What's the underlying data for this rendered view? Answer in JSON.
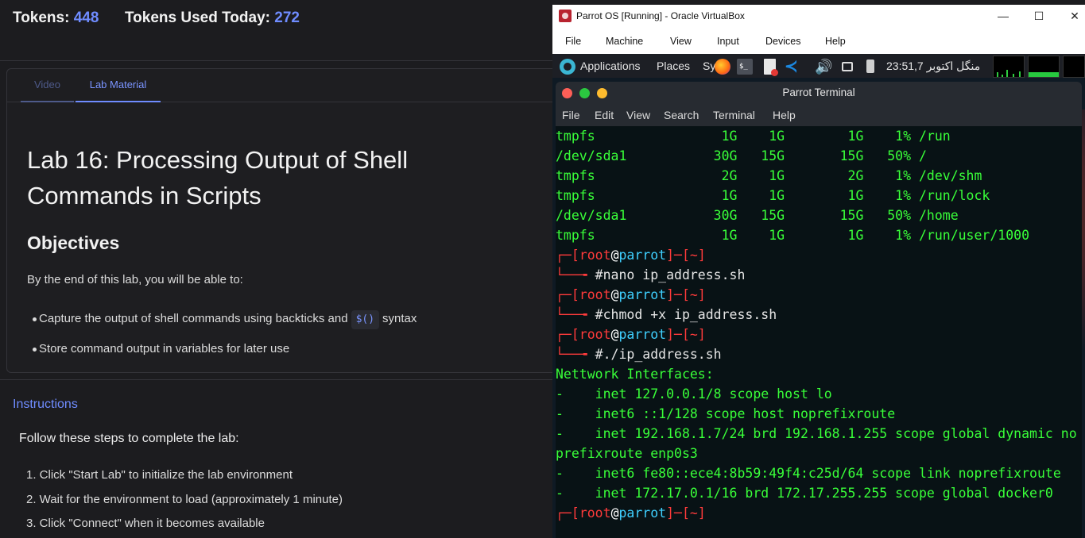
{
  "header": {
    "tokens_label": "Tokens:",
    "tokens_value": "448",
    "tokens_used_label": "Tokens Used Today:",
    "tokens_used_value": "272"
  },
  "tabs": [
    {
      "label": "Video",
      "active": false
    },
    {
      "label": "Lab Material",
      "active": true
    }
  ],
  "lab": {
    "title": "Lab 16: Processing Output of Shell Commands in Scripts",
    "objectives_heading": "Objectives",
    "objectives_intro": "By the end of this lab, you will be able to:",
    "objectives": [
      {
        "before": "Capture the output of shell commands using backticks and",
        "code": "$()",
        "after": "syntax"
      },
      {
        "before": "Store command output in variables for later use"
      }
    ]
  },
  "instructions": {
    "heading": "Instructions",
    "intro": "Follow these steps to complete the lab:",
    "steps": [
      "1. Click \"Start Lab\" to initialize the lab environment",
      "2. Wait for the environment to load (approximately 1 minute)",
      "3. Click \"Connect\" when it becomes available"
    ]
  },
  "vbox": {
    "title": "Parrot OS [Running] - Oracle VirtualBox",
    "menu": [
      "File",
      "Machine",
      "View",
      "Input",
      "Devices",
      "Help"
    ],
    "window_controls": {
      "minimize": "—",
      "maximize": "☐",
      "close": "✕"
    }
  },
  "parrot_panel": {
    "items": [
      "Applications",
      "Places",
      "Sy"
    ],
    "clock": "23:51,7 منگل اکتوبر",
    "icons": [
      "parrot-logo-icon",
      "firefox-icon",
      "terminal-icon",
      "document-icon",
      "vscode-icon",
      "speaker-icon",
      "screen-icon",
      "battery-icon"
    ],
    "term_icon_glyph": "$_",
    "vscode_glyph": "≺",
    "speaker_glyph": "🔊"
  },
  "terminal": {
    "title": "Parrot Terminal",
    "menu": [
      "File",
      "Edit",
      "View",
      "Search",
      "Terminal",
      "Help"
    ],
    "df_rows": [
      {
        "fs": "tmpfs",
        "size": "1G",
        "used": "1G",
        "avail": "1G",
        "use": "1%",
        "mount": "/run"
      },
      {
        "fs": "/dev/sda1",
        "size": "30G",
        "used": "15G",
        "avail": "15G",
        "use": "50%",
        "mount": "/"
      },
      {
        "fs": "tmpfs",
        "size": "2G",
        "used": "1G",
        "avail": "2G",
        "use": "1%",
        "mount": "/dev/shm"
      },
      {
        "fs": "tmpfs",
        "size": "1G",
        "used": "1G",
        "avail": "1G",
        "use": "1%",
        "mount": "/run/lock"
      },
      {
        "fs": "/dev/sda1",
        "size": "30G",
        "used": "15G",
        "avail": "15G",
        "use": "50%",
        "mount": "/home"
      },
      {
        "fs": "tmpfs",
        "size": "1G",
        "used": "1G",
        "avail": "1G",
        "use": "1%",
        "mount": "/run/user/1000"
      }
    ],
    "prompt": {
      "user": "root",
      "at": "@",
      "host": "parrot",
      "dir": "~"
    },
    "commands": [
      "nano ip_address.sh",
      "chmod +x ip_address.sh",
      "./ip_address.sh"
    ],
    "output_lines": [
      "Nettwork Interfaces:",
      "-    inet 127.0.0.1/8 scope host lo",
      "-    inet6 ::1/128 scope host noprefixroute",
      "-    inet 192.168.1.7/24 brd 192.168.1.255 scope global dynamic no",
      "prefixroute enp0s3",
      "-    inet6 fe80::ece4:8b59:49f4:c25d/64 scope link noprefixroute",
      "-    inet 172.17.0.1/16 brd 172.17.255.255 scope global docker0"
    ]
  },
  "colors": {
    "accent": "#6f8cff",
    "terminal_green": "#39ff39",
    "prompt_red": "#ff3b3b",
    "prompt_host": "#3fd0ff",
    "left_bg": "#1c1c1f"
  }
}
